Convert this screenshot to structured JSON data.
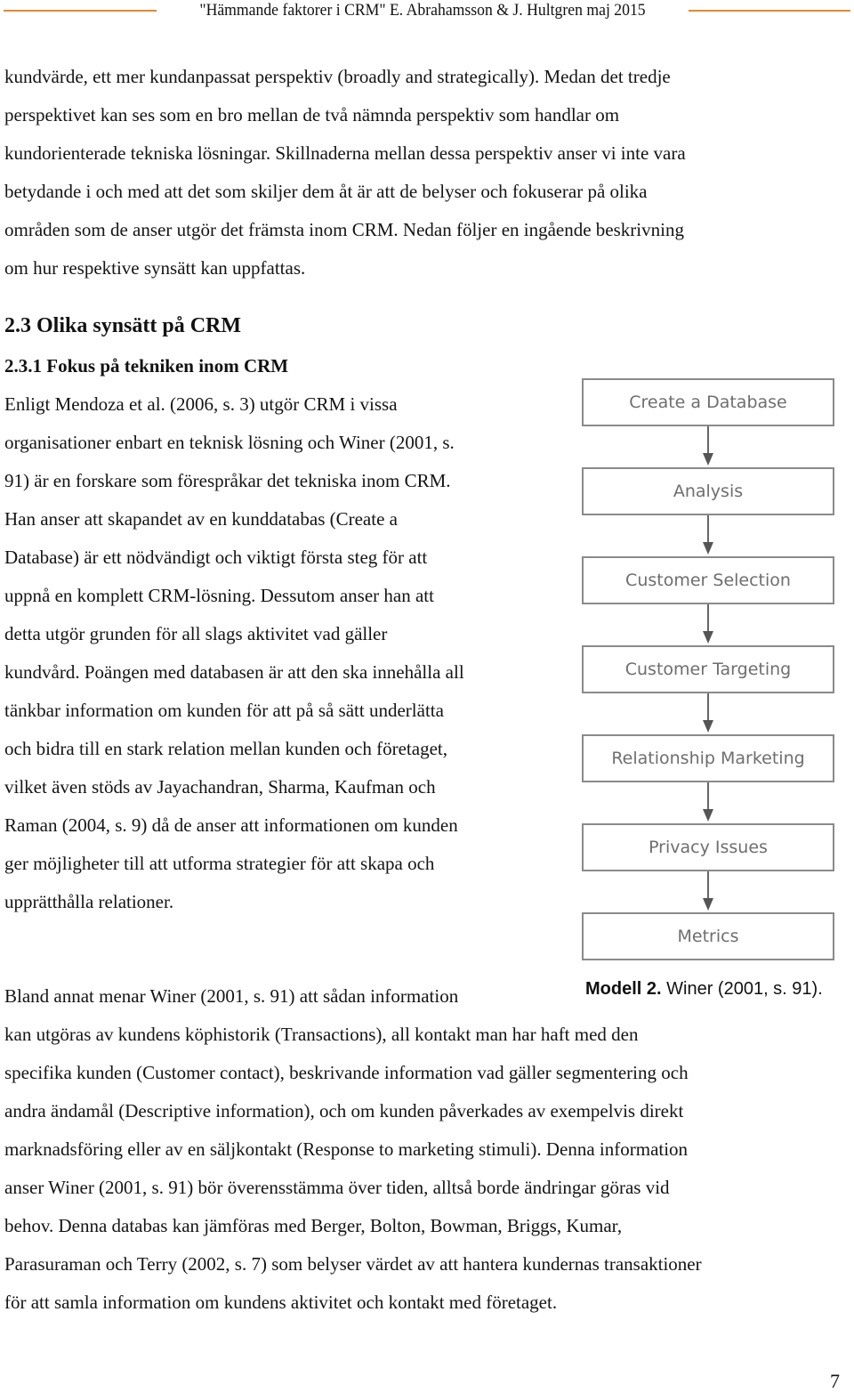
{
  "header": {
    "running_title": "\"Hämmande faktorer i CRM\" E. Abrahamsson & J. Hultgren maj 2015",
    "rule_color": "#e08a2e"
  },
  "intro_lines": [
    "kundvärde, ett mer kundanpassat perspektiv (broadly and strategically). Medan det tredje",
    "perspektivet kan ses som en bro mellan de två nämnda perspektiv som handlar om",
    "kundorienterade tekniska lösningar. Skillnaderna mellan dessa perspektiv anser vi inte vara",
    "betydande i och med att det som skiljer dem åt är att de belyser och fokuserar på olika",
    "områden som de anser utgör det främsta inom CRM. Nedan följer en ingående beskrivning",
    "om hur respektive synsätt kan uppfattas."
  ],
  "section": {
    "heading": "2.3 Olika synsätt på CRM",
    "subheading": "2.3.1 Fokus på tekniken inom CRM"
  },
  "body_lines_left": [
    "Enligt Mendoza et al. (2006, s. 3) utgör CRM i vissa",
    "organisationer enbart en teknisk lösning och Winer (2001, s.",
    "91) är en forskare som förespråkar det tekniska inom CRM.",
    "Han anser att skapandet av en kunddatabas (Create a",
    "Database) är ett nödvändigt och viktigt första steg för att",
    "uppnå en komplett CRM-lösning. Dessutom anser han att",
    "detta utgör grunden för all slags aktivitet vad gäller",
    "kundvård. Poängen med databasen är att den ska innehålla all",
    "tänkbar information om kunden för att på så sätt underlätta",
    "och bidra till en stark relation mellan kunden och företaget,",
    "vilket även stöds av Jayachandran, Sharma, Kaufman och",
    "Raman (2004, s. 9) då de anser att informationen om kunden",
    "ger möjligheter till att utforma strategier för att skapa och",
    "upprätthålla relationer."
  ],
  "figure": {
    "steps": [
      "Create a Database",
      "Analysis",
      "Customer Selection",
      "Customer Targeting",
      "Relationship Marketing",
      "Privacy Issues",
      "Metrics"
    ],
    "caption_bold": "Modell 2.",
    "caption_rest": " Winer (2001, s. 91)."
  },
  "body_lines_full": [
    "Bland annat menar Winer (2001, s. 91) att sådan information",
    "kan utgöras av kundens köphistorik (Transactions), all kontakt man har haft med den",
    "specifika kunden (Customer contact), beskrivande information vad gäller segmentering och",
    "andra ändamål (Descriptive information), och om kunden påverkades av exempelvis direkt",
    "marknadsföring eller av en säljkontakt (Response to marketing stimuli). Denna information",
    "anser Winer (2001, s. 91) bör överensstämma över tiden, alltså borde ändringar göras vid",
    "behov. Denna databas kan jämföras med Berger, Bolton, Bowman, Briggs, Kumar,",
    "Parasuraman och Terry (2002, s. 7) som belyser värdet av att hantera kundernas transaktioner",
    "för att samla information om kundens aktivitet och kontakt med företaget."
  ],
  "page_number": "7"
}
